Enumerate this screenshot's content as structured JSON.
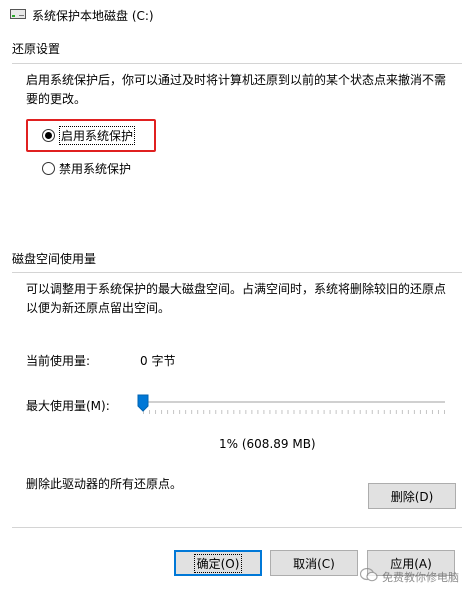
{
  "window": {
    "title": "系统保护本地磁盘 (C:)",
    "icon": "drive-icon"
  },
  "restore_settings": {
    "section_title": "还原设置",
    "description_line1": "启用系统保护后，你可以通过及时将计算机还原到以前的某个状态点来撤消不需",
    "description_line2": "要的更改。",
    "options": [
      {
        "label": "启用系统保护",
        "selected": true
      },
      {
        "label": "禁用系统保护",
        "selected": false
      }
    ]
  },
  "disk_usage": {
    "section_title": "磁盘空间使用量",
    "description_line1": "可以调整用于系统保护的最大磁盘空间。占满空间时，系统将删除较旧的还原点",
    "description_line2": "以便为新还原点留出空间。",
    "current_usage_label": "当前使用量:",
    "current_usage_value": "0 字节",
    "max_usage_label": "最大使用量(M):",
    "max_usage_percent": 1,
    "max_usage_text": "1% (608.89 MB)",
    "delete_description": "删除此驱动器的所有还原点。",
    "delete_button": "删除(D)"
  },
  "buttons": {
    "ok": "确定(O)",
    "cancel": "取消(C)",
    "apply": "应用(A)"
  },
  "watermark": {
    "text": "免费教你修电脑",
    "icon": "wechat-icon"
  },
  "colors": {
    "highlight": "#e02020",
    "accent": "#0078d7",
    "slider_thumb": "#0078d7"
  }
}
